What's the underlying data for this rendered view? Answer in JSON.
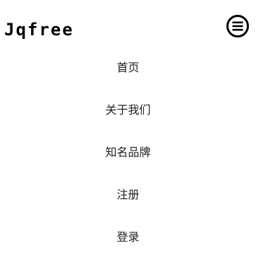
{
  "header": {
    "logo_text": "Jqfree",
    "menu_icon": "hamburger-menu-icon"
  },
  "nav": {
    "items": [
      {
        "label": "首页"
      },
      {
        "label": "关于我们"
      },
      {
        "label": "知名品牌"
      },
      {
        "label": "注册"
      },
      {
        "label": "登录"
      }
    ]
  },
  "colors": {
    "background": "#ffffff",
    "text": "#222222",
    "logo": "#000000"
  }
}
